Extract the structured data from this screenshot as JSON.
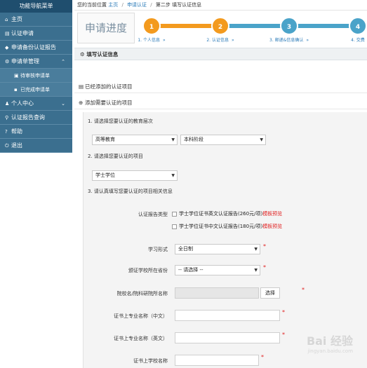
{
  "sidebar": {
    "header": "功能导航菜单",
    "items": [
      {
        "icon": "home-icon",
        "glyph": "⌂",
        "label": "主页",
        "sub": false,
        "caret": ""
      },
      {
        "icon": "document-icon",
        "glyph": "▤",
        "label": "认证申请",
        "sub": false,
        "caret": ""
      },
      {
        "icon": "tag-icon",
        "glyph": "◆",
        "label": "申请备份认证报告",
        "sub": false,
        "caret": ""
      },
      {
        "icon": "gear-icon",
        "glyph": "⚙",
        "label": "申请单管理",
        "sub": false,
        "caret": "⌃"
      },
      {
        "icon": "cart-icon",
        "glyph": "▣",
        "label": "待审核申请单",
        "sub": true,
        "caret": ""
      },
      {
        "icon": "briefcase-icon",
        "glyph": "▪",
        "label": "已完成申请单",
        "sub": true,
        "caret": ""
      },
      {
        "icon": "user-icon",
        "glyph": "♟",
        "label": "个人中心",
        "sub": false,
        "caret": "⌄"
      },
      {
        "icon": "search-icon",
        "glyph": "⚲",
        "label": "认证报告查询",
        "sub": false,
        "caret": ""
      },
      {
        "icon": "help-icon",
        "glyph": "?",
        "label": "帮助",
        "sub": false,
        "caret": ""
      },
      {
        "icon": "logout-icon",
        "glyph": "⏻",
        "label": "退出",
        "sub": false,
        "caret": ""
      }
    ]
  },
  "breadcrumb": {
    "prefix": "您的当前位置",
    "home": "主页",
    "parent": "申请认证",
    "current": "第二步 填写认证信息"
  },
  "steps": {
    "title": "申请进度",
    "active_color": "#f39a1e",
    "inactive_color": "#4aa3c9",
    "items": [
      {
        "num": "1",
        "label": "1. 个人信息",
        "arrow": "»",
        "done": true
      },
      {
        "num": "2",
        "label": "2. 认证信息",
        "arrow": "»",
        "done": true
      },
      {
        "num": "3",
        "label": "3. 邮递&信息确认",
        "arrow": "»",
        "done": false
      },
      {
        "num": "4",
        "label": "4. 交费",
        "arrow": "",
        "done": false
      }
    ]
  },
  "section": {
    "title": "填写认证信息"
  },
  "added": {
    "label": "已经添加的认证项目"
  },
  "add_new": {
    "label": "添加需要认证的项目"
  },
  "form": {
    "q1": "1. 请选择您要认证的教育层次",
    "level_select": "高等教育",
    "stage_select": "本科阶段",
    "q2": "2. 请选择您要认证的项目",
    "project_select": "学士学位",
    "q3": "3. 请认真填写您要认证的项目相关信息",
    "report_type_label": "认证报告类型",
    "opt_en": "学士学位证书英文认证报告(260元/项)",
    "opt_zh": "学士学位证书中文认证报告(180元/项)",
    "preview": "模板预览",
    "study_form_label": "学习形式",
    "study_form_value": "全日制",
    "province_label": "颁证学校所在省份",
    "province_value": "-- 请选择 --",
    "school_label": "院校名/院科研院所名称",
    "choose_button": "选择",
    "major_zh_label": "证书上专业名称（中文）",
    "major_en_label": "证书上专业名称（英文）",
    "cert_school_label": "证书上学校名称",
    "required_mark": "*"
  },
  "watermark": {
    "brand": "Bai 经验",
    "url": "jingyan.baidu.com"
  }
}
